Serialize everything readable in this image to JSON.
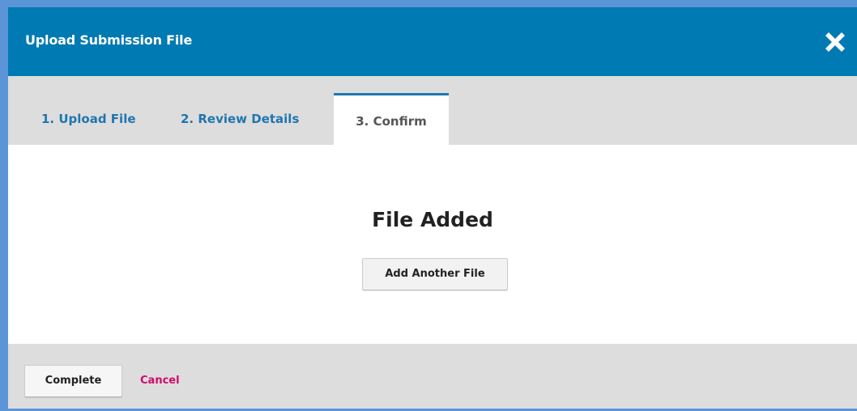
{
  "modal": {
    "title": "Upload Submission File",
    "close_icon": "close-x-icon"
  },
  "tabs": [
    {
      "label": "1. Upload File",
      "active": false
    },
    {
      "label": "2. Review Details",
      "active": false
    },
    {
      "label": "3. Confirm",
      "active": true
    }
  ],
  "content": {
    "title": "File Added",
    "add_another_label": "Add Another File"
  },
  "footer": {
    "complete_label": "Complete",
    "cancel_label": "Cancel"
  },
  "colors": {
    "header_bg": "#007ab2",
    "tab_link": "#1f76b0",
    "tab_active_text": "#555555",
    "bar_bg": "#dddddd",
    "cancel_link": "#d00a6c",
    "outer_bg": "#5b95d8"
  }
}
